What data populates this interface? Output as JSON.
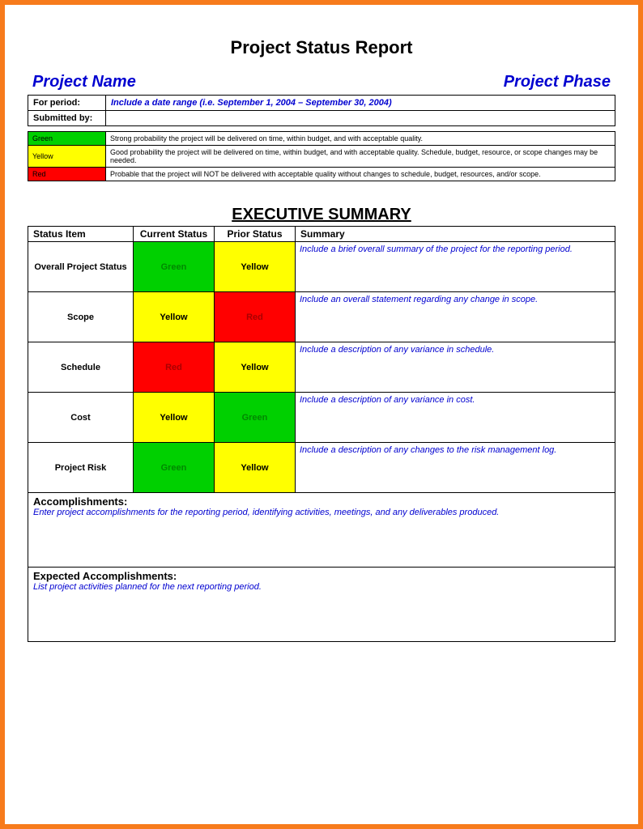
{
  "title": "Project Status Report",
  "header_left": "Project Name",
  "header_right": "Project Phase",
  "meta": {
    "for_period_label": "For period:",
    "for_period_value": "Include a date range (i.e. September 1, 2004 – September 30, 2004)",
    "submitted_by_label": "Submitted by:",
    "submitted_by_value": ""
  },
  "legend": [
    {
      "color": "green",
      "label": "Green",
      "desc": "Strong probability the project will be delivered on time, within budget, and with acceptable quality."
    },
    {
      "color": "yellow",
      "label": "Yellow",
      "desc": "Good probability the project will be delivered on time, within budget, and with acceptable quality. Schedule, budget, resource, or scope changes may be needed."
    },
    {
      "color": "red",
      "label": "Red",
      "desc": "Probable that the project will NOT be delivered with acceptable quality without changes to schedule, budget, resources, and/or scope."
    }
  ],
  "exec_title": "EXECUTIVE SUMMARY",
  "exec_headers": {
    "item": "Status Item",
    "current": "Current Status",
    "prior": "Prior Status",
    "summary": "Summary"
  },
  "rows": [
    {
      "item": "Overall Project Status",
      "current": "Green",
      "prior": "Yellow",
      "summary": "Include a brief overall summary of the project for the reporting period."
    },
    {
      "item": "Scope",
      "current": "Yellow",
      "prior": "Red",
      "summary": "Include an overall statement regarding any change in scope."
    },
    {
      "item": "Schedule",
      "current": "Red",
      "prior": "Yellow",
      "summary": "Include a description of any variance in schedule."
    },
    {
      "item": "Cost",
      "current": "Yellow",
      "prior": "Green",
      "summary": "Include a description of any variance in cost."
    },
    {
      "item": "Project Risk",
      "current": "Green",
      "prior": "Yellow",
      "summary": "Include a description of any changes to the risk management log."
    }
  ],
  "accomplishments": {
    "label": "Accomplishments:",
    "text": "Enter project accomplishments for the reporting period, identifying activities, meetings, and any deliverables produced."
  },
  "expected": {
    "label": "Expected Accomplishments:",
    "text": "List project activities planned for the next reporting period."
  }
}
